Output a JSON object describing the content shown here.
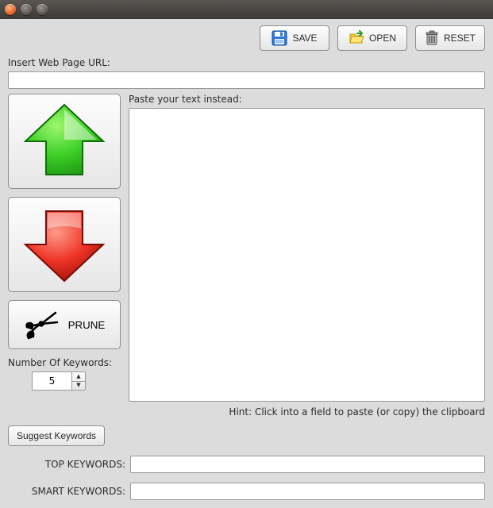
{
  "toolbar": {
    "save_label": "SAVE",
    "open_label": "OPEN",
    "reset_label": "RESET"
  },
  "url_section": {
    "label": "Insert Web Page URL:",
    "value": ""
  },
  "paste_section": {
    "label": "Paste your text instead:",
    "value": ""
  },
  "left": {
    "prune_label": "PRUNE"
  },
  "keywords": {
    "count_label": "Number Of Keywords:",
    "count_value": "5",
    "suggest_label": "Suggest Keywords",
    "top_label": "TOP KEYWORDS:",
    "top_value": "",
    "smart_label": "SMART KEYWORDS:",
    "smart_value": ""
  },
  "hint": "Hint: Click into a field to paste (or copy) the clipboard"
}
